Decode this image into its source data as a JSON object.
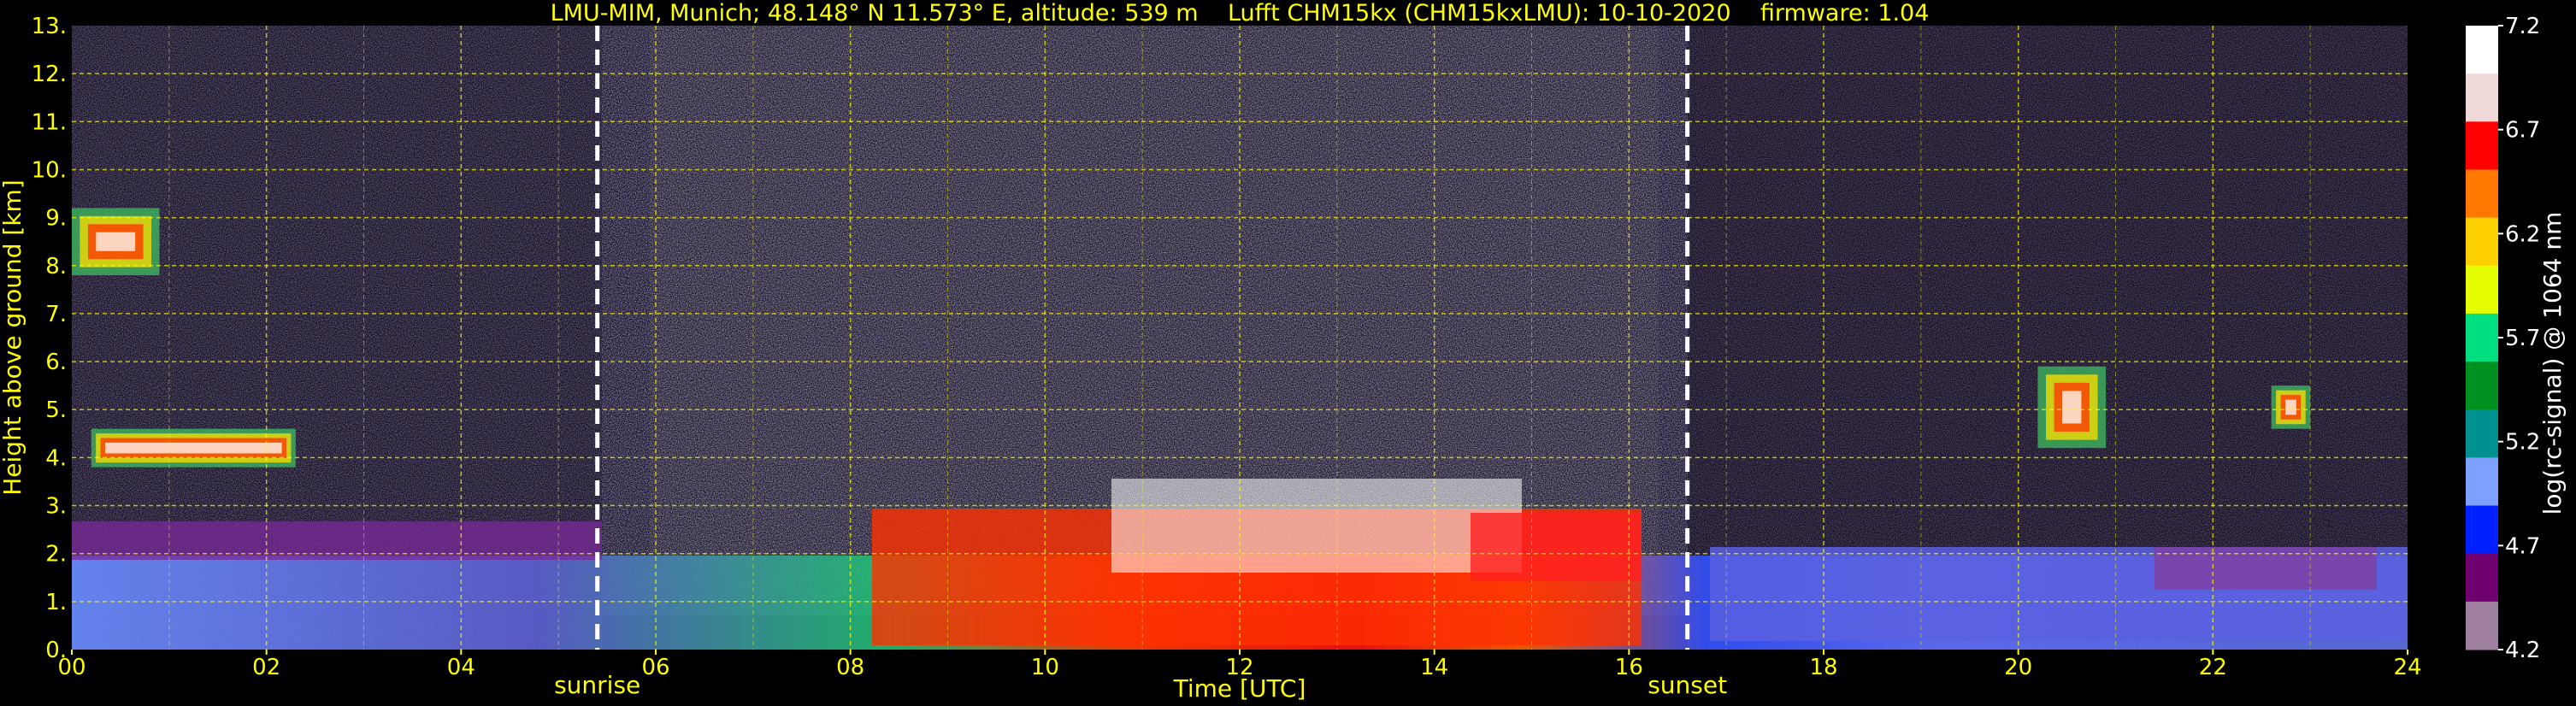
{
  "chart_data": {
    "type": "heatmap",
    "title": "LMU-MIM, Munich; 48.148° N 11.573° E, altitude: 539 m    Lufft CHM15kx (CHM15kxLMU): 10-10-2020    firmware: 1.04",
    "xlabel": "Time [UTC]",
    "ylabel": "Height above ground [km]",
    "colorbar_label": "log(rc-signal) @ 1064 nm",
    "xlim": [
      0,
      24
    ],
    "ylim": [
      0,
      13
    ],
    "clim": [
      4.2,
      7.2
    ],
    "x_ticks": [
      "00",
      "02",
      "04",
      "06",
      "08",
      "10",
      "12",
      "14",
      "16",
      "18",
      "20",
      "22",
      "24"
    ],
    "y_ticks": [
      "0.",
      "1.",
      "2.",
      "3.",
      "4.",
      "5.",
      "6.",
      "7.",
      "8.",
      "9.",
      "10.",
      "11.",
      "12.",
      "13."
    ],
    "colorbar_ticks": [
      "4.2",
      "4.7",
      "5.2",
      "5.7",
      "6.2",
      "6.7",
      "7.2"
    ],
    "grid": true,
    "markers": [
      {
        "label": "sunrise",
        "time_hours": 5.4
      },
      {
        "label": "sunset",
        "time_hours": 16.6
      }
    ],
    "features": [
      {
        "kind": "cloud",
        "time_start": 0.0,
        "time_end": 0.9,
        "height_base_km": 7.8,
        "height_top_km": 9.2
      },
      {
        "kind": "cloud",
        "time_start": 0.2,
        "time_end": 2.3,
        "height_base_km": 3.8,
        "height_top_km": 4.6
      },
      {
        "kind": "cloud",
        "time_start": 20.2,
        "time_end": 20.9,
        "height_base_km": 4.2,
        "height_top_km": 5.9
      },
      {
        "kind": "cloud",
        "time_start": 22.6,
        "time_end": 23.0,
        "height_base_km": 4.6,
        "height_top_km": 5.5
      },
      {
        "kind": "boundary-layer",
        "time_start": 0.0,
        "time_end": 24.0,
        "height_base_km": 0.0,
        "height_top_km": 2.0
      }
    ]
  },
  "colors": {
    "axis_text": "#ffff00",
    "grid": "#ffff00",
    "colorbar_text": "#ffffff",
    "colormap": [
      "#ffffff",
      "#f0d8d8",
      "#ff0000",
      "#ff7800",
      "#ffd000",
      "#e6ff00",
      "#00e080",
      "#009020",
      "#009090",
      "#7fa0ff",
      "#0020ff",
      "#700070",
      "#a080a0"
    ]
  }
}
